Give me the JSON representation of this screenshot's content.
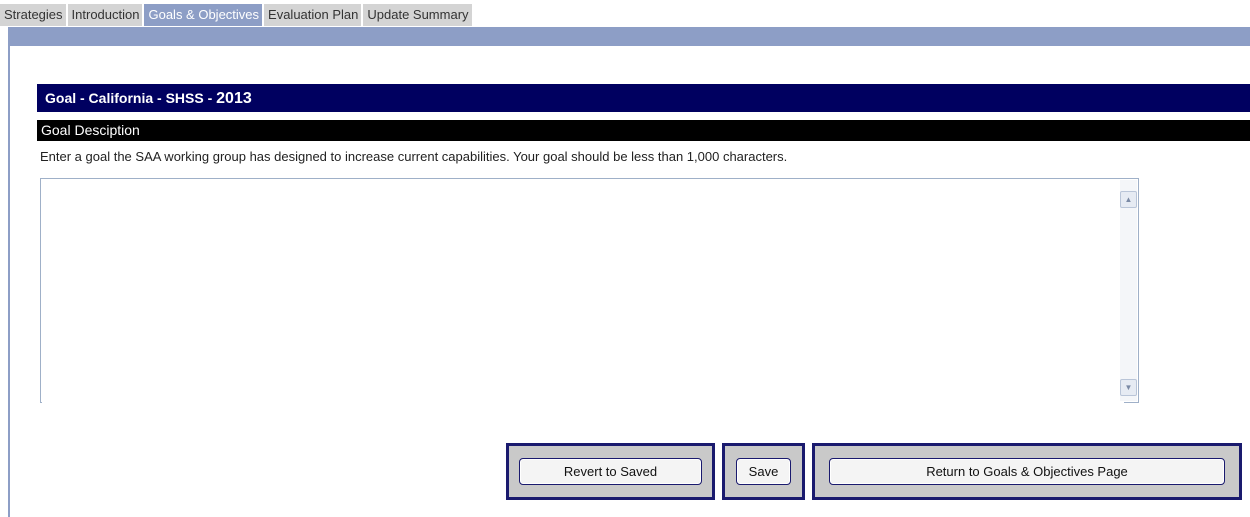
{
  "tabs": [
    {
      "label": "Strategies"
    },
    {
      "label": "Introduction"
    },
    {
      "label": "Goals & Objectives"
    },
    {
      "label": "Evaluation Plan"
    },
    {
      "label": "Update Summary"
    }
  ],
  "active_tab": "Goals & Objectives",
  "goal_header": {
    "prefix": "Goal - California - SHSS - ",
    "year": "2013"
  },
  "goal_description": {
    "title": "Goal Desciption",
    "instruction": "Enter a goal the SAA working group has designed to increase current capabilities. Your goal should be less than 1,000 characters.",
    "value": ""
  },
  "buttons": {
    "revert": "Revert to Saved",
    "save": "Save",
    "return": "Return to Goals & Objectives Page"
  },
  "colors": {
    "tab_active": "#8d9ec6",
    "header_bg": "#000060",
    "frame_border": "#1a1a6e"
  }
}
